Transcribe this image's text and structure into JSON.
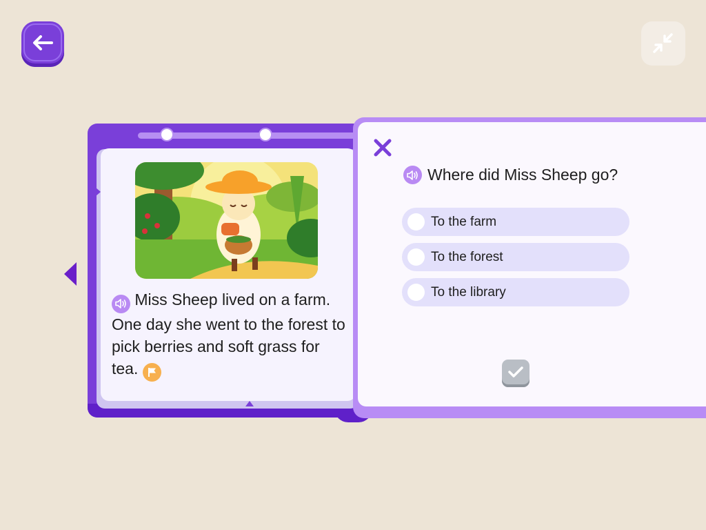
{
  "header": {
    "back_icon": "arrow-left-icon",
    "collapse_icon": "collapse-arrows-icon"
  },
  "reader": {
    "progress": {
      "steps": 3,
      "current": 2
    },
    "story_text": "Miss Sheep lived on a farm. One day she went to the forest to pick berries and soft grass for tea.",
    "audio_icon": "speaker-icon",
    "flag_icon": "flag-icon",
    "prev_icon": "caret-left-icon"
  },
  "quiz": {
    "close_icon": "close-icon",
    "question": "Where did Miss Sheep go?",
    "options": [
      {
        "label": "To the farm"
      },
      {
        "label": "To the forest"
      },
      {
        "label": "To the library"
      }
    ],
    "submit_icon": "checkmark-icon"
  },
  "colors": {
    "background": "#ede4d6",
    "brand_purple": "#7a3fd9",
    "option_bg": "#e3e0fb",
    "flag_orange": "#f7b04f",
    "submit_disabled": "#b9bec5"
  }
}
